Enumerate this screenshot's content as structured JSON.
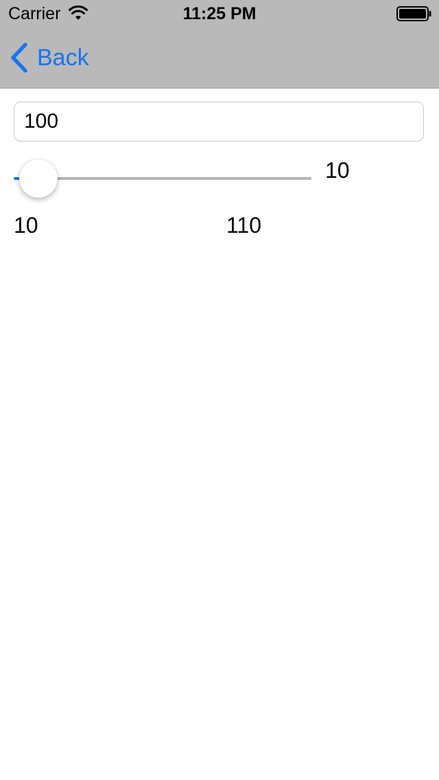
{
  "status_bar": {
    "carrier": "Carrier",
    "time": "11:25 PM",
    "wifi_icon": "wifi-icon",
    "battery_icon": "battery-full-icon"
  },
  "nav": {
    "back_label": "Back",
    "back_icon": "chevron-left-icon",
    "accent_color": "#1a73f0",
    "bar_color": "#b9b9b9"
  },
  "form": {
    "text_value": "100",
    "slider": {
      "value": 10,
      "value_label": "10",
      "min": 10,
      "max": 110,
      "min_label": "10",
      "max_label": "110"
    }
  }
}
